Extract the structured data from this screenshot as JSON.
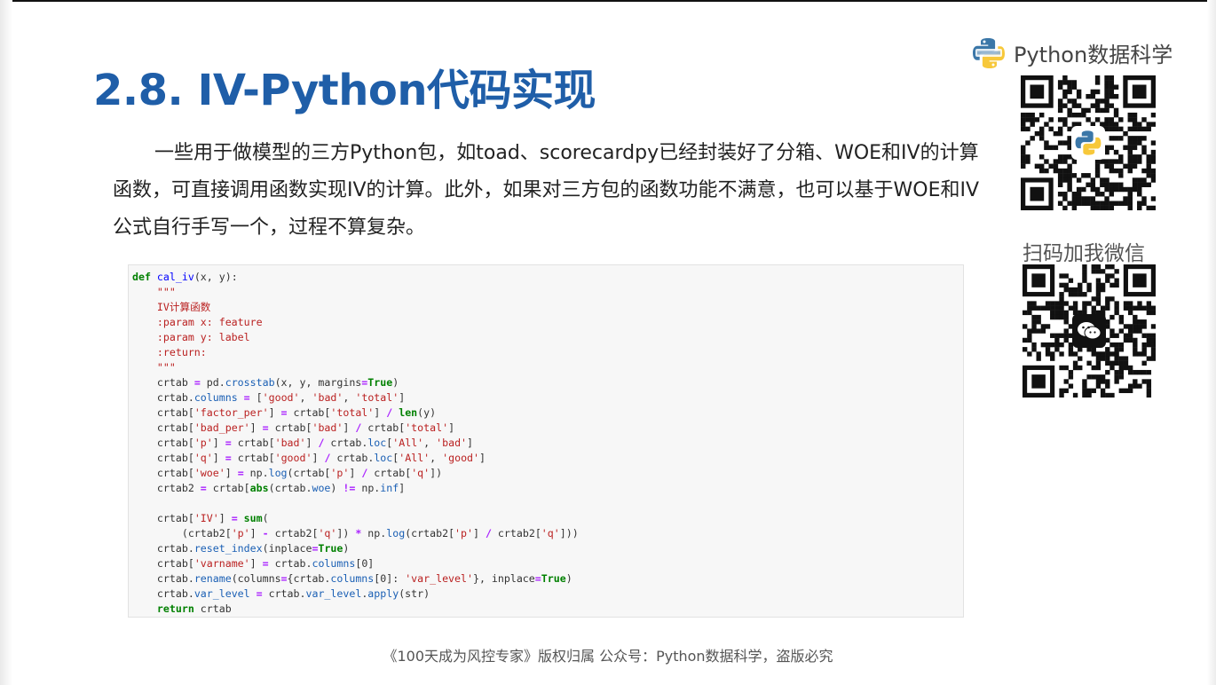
{
  "slide": {
    "title": "2.8. IV-Python代码实现",
    "paragraph": "一些用于做模型的三方Python包，如toad、scorecardpy已经封装好了分箱、WOE和IV的计算函数，可直接调用函数实现IV的计算。此外，如果对三方包的函数功能不满意，也可以基于WOE和IV公式自行手写一个，过程不算复杂。",
    "footer": "《100天成为风控专家》版权归属 公众号：Python数据科学，盗版必究"
  },
  "brand": {
    "name": "Python数据科学",
    "logo_icon": "python-logo-icon",
    "scan_label": "扫码加我微信"
  },
  "code": {
    "language": "python",
    "lines": [
      [
        [
          "kw",
          "def "
        ],
        [
          "fn",
          "cal_iv"
        ],
        [
          "",
          "(x, y):"
        ]
      ],
      [
        [
          "doc",
          "    \"\"\""
        ]
      ],
      [
        [
          "doc",
          "    IV计算函数"
        ]
      ],
      [
        [
          "doc",
          "    :param x: feature"
        ]
      ],
      [
        [
          "doc",
          "    :param y: label"
        ]
      ],
      [
        [
          "doc",
          "    :return:"
        ]
      ],
      [
        [
          "doc",
          "    \"\"\""
        ]
      ],
      [
        [
          "",
          "    crtab "
        ],
        [
          "op",
          "="
        ],
        [
          "",
          " pd."
        ],
        [
          "attr",
          "crosstab"
        ],
        [
          "",
          "(x, y, margins"
        ],
        [
          "op",
          "="
        ],
        [
          "kw",
          "True"
        ],
        [
          "",
          ")"
        ]
      ],
      [
        [
          "",
          "    crtab."
        ],
        [
          "attr",
          "columns"
        ],
        [
          "",
          " "
        ],
        [
          "op",
          "="
        ],
        [
          "",
          " ["
        ],
        [
          "str",
          "'good'"
        ],
        [
          "",
          ", "
        ],
        [
          "str",
          "'bad'"
        ],
        [
          "",
          ", "
        ],
        [
          "str",
          "'total'"
        ],
        [
          "",
          "]"
        ]
      ],
      [
        [
          "",
          "    crtab["
        ],
        [
          "str",
          "'factor_per'"
        ],
        [
          "",
          "] "
        ],
        [
          "op",
          "="
        ],
        [
          "",
          " crtab["
        ],
        [
          "str",
          "'total'"
        ],
        [
          "",
          "] "
        ],
        [
          "op",
          "/"
        ],
        [
          "",
          " "
        ],
        [
          "kw",
          "len"
        ],
        [
          "",
          "(y)"
        ]
      ],
      [
        [
          "",
          "    crtab["
        ],
        [
          "str",
          "'bad_per'"
        ],
        [
          "",
          "] "
        ],
        [
          "op",
          "="
        ],
        [
          "",
          " crtab["
        ],
        [
          "str",
          "'bad'"
        ],
        [
          "",
          "] "
        ],
        [
          "op",
          "/"
        ],
        [
          "",
          " crtab["
        ],
        [
          "str",
          "'total'"
        ],
        [
          "",
          "]"
        ]
      ],
      [
        [
          "",
          "    crtab["
        ],
        [
          "str",
          "'p'"
        ],
        [
          "",
          "] "
        ],
        [
          "op",
          "="
        ],
        [
          "",
          " crtab["
        ],
        [
          "str",
          "'bad'"
        ],
        [
          "",
          "] "
        ],
        [
          "op",
          "/"
        ],
        [
          "",
          " crtab."
        ],
        [
          "attr",
          "loc"
        ],
        [
          "",
          "["
        ],
        [
          "str",
          "'All'"
        ],
        [
          "",
          ", "
        ],
        [
          "str",
          "'bad'"
        ],
        [
          "",
          "]"
        ]
      ],
      [
        [
          "",
          "    crtab["
        ],
        [
          "str",
          "'q'"
        ],
        [
          "",
          "] "
        ],
        [
          "op",
          "="
        ],
        [
          "",
          " crtab["
        ],
        [
          "str",
          "'good'"
        ],
        [
          "",
          "] "
        ],
        [
          "op",
          "/"
        ],
        [
          "",
          " crtab."
        ],
        [
          "attr",
          "loc"
        ],
        [
          "",
          "["
        ],
        [
          "str",
          "'All'"
        ],
        [
          "",
          ", "
        ],
        [
          "str",
          "'good'"
        ],
        [
          "",
          "]"
        ]
      ],
      [
        [
          "",
          "    crtab["
        ],
        [
          "str",
          "'woe'"
        ],
        [
          "",
          "] "
        ],
        [
          "op",
          "="
        ],
        [
          "",
          " np."
        ],
        [
          "attr",
          "log"
        ],
        [
          "",
          "(crtab["
        ],
        [
          "str",
          "'p'"
        ],
        [
          "",
          "] "
        ],
        [
          "op",
          "/"
        ],
        [
          "",
          " crtab["
        ],
        [
          "str",
          "'q'"
        ],
        [
          "",
          "])"
        ]
      ],
      [
        [
          "",
          "    crtab2 "
        ],
        [
          "op",
          "="
        ],
        [
          "",
          " crtab["
        ],
        [
          "kw",
          "abs"
        ],
        [
          "",
          "(crtab."
        ],
        [
          "attr",
          "woe"
        ],
        [
          "",
          ") "
        ],
        [
          "op",
          "!="
        ],
        [
          "",
          " np."
        ],
        [
          "attr",
          "inf"
        ],
        [
          "",
          "]"
        ]
      ],
      [
        [
          "",
          ""
        ]
      ],
      [
        [
          "",
          "    crtab["
        ],
        [
          "str",
          "'IV'"
        ],
        [
          "",
          "] "
        ],
        [
          "op",
          "="
        ],
        [
          "",
          " "
        ],
        [
          "kw",
          "sum"
        ],
        [
          "",
          "("
        ]
      ],
      [
        [
          "",
          "        (crtab2["
        ],
        [
          "str",
          "'p'"
        ],
        [
          "",
          "] "
        ],
        [
          "op",
          "-"
        ],
        [
          "",
          " crtab2["
        ],
        [
          "str",
          "'q'"
        ],
        [
          "",
          "]) "
        ],
        [
          "op",
          "*"
        ],
        [
          "",
          " np."
        ],
        [
          "attr",
          "log"
        ],
        [
          "",
          "(crtab2["
        ],
        [
          "str",
          "'p'"
        ],
        [
          "",
          "] "
        ],
        [
          "op",
          "/"
        ],
        [
          "",
          " crtab2["
        ],
        [
          "str",
          "'q'"
        ],
        [
          "",
          "]))"
        ]
      ],
      [
        [
          "",
          "    crtab."
        ],
        [
          "attr",
          "reset_index"
        ],
        [
          "",
          "(inplace"
        ],
        [
          "op",
          "="
        ],
        [
          "kw",
          "True"
        ],
        [
          "",
          ")"
        ]
      ],
      [
        [
          "",
          "    crtab["
        ],
        [
          "str",
          "'varname'"
        ],
        [
          "",
          "] "
        ],
        [
          "op",
          "="
        ],
        [
          "",
          " crtab."
        ],
        [
          "attr",
          "columns"
        ],
        [
          "",
          "[0]"
        ]
      ],
      [
        [
          "",
          "    crtab."
        ],
        [
          "attr",
          "rename"
        ],
        [
          "",
          "(columns"
        ],
        [
          "op",
          "="
        ],
        [
          "",
          "{crtab."
        ],
        [
          "attr",
          "columns"
        ],
        [
          "",
          "[0]: "
        ],
        [
          "str",
          "'var_level'"
        ],
        [
          "",
          "}, inplace"
        ],
        [
          "op",
          "="
        ],
        [
          "kw",
          "True"
        ],
        [
          "",
          ")"
        ]
      ],
      [
        [
          "",
          "    crtab."
        ],
        [
          "attr",
          "var_level"
        ],
        [
          "",
          " "
        ],
        [
          "op",
          "="
        ],
        [
          "",
          " crtab."
        ],
        [
          "attr",
          "var_level"
        ],
        [
          "",
          "."
        ],
        [
          "attr",
          "apply"
        ],
        [
          "",
          "(str)"
        ]
      ],
      [
        [
          "kw",
          "    return"
        ],
        [
          "",
          " crtab"
        ]
      ]
    ]
  },
  "colors": {
    "title": "#1f5ea8",
    "keyword": "#008000",
    "function": "#0000ff",
    "string": "#ba2121",
    "operator": "#aa22ff"
  }
}
